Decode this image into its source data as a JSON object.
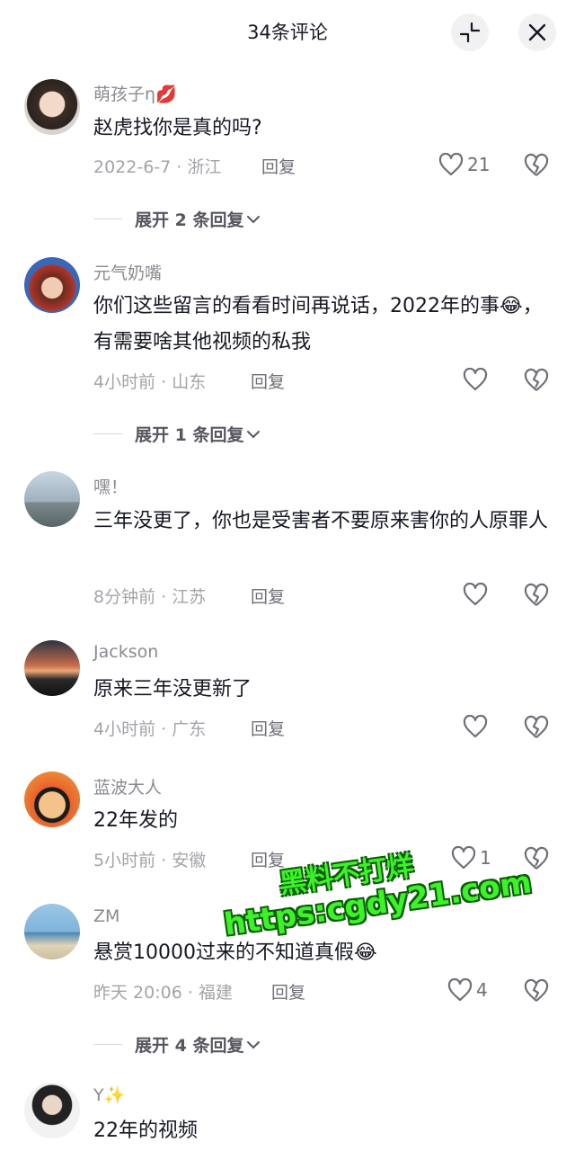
{
  "header": {
    "title": "34条评论"
  },
  "comments": [
    {
      "username": "萌孩子η💋",
      "text": "赵虎找你是真的吗?",
      "meta": "2022-6-7 · 浙江",
      "reply": "回复",
      "likes": "21",
      "expand": "展开 2 条回复"
    },
    {
      "username": "元气奶嘴",
      "text": "你们这些留言的看看时间再说话，2022年的事😂，有需要啥其他视频的私我",
      "meta": "4小时前 · 山东",
      "reply": "回复",
      "likes": "",
      "expand": "展开 1 条回复"
    },
    {
      "username": "嘿！",
      "text": "三年没更了，你也是受害者不要原来害你的人原罪人",
      "meta": "8分钟前 · 江苏",
      "reply": "回复",
      "likes": ""
    },
    {
      "username": "Jackson",
      "text": "原来三年没更新了",
      "meta": "4小时前 · 广东",
      "reply": "回复",
      "likes": ""
    },
    {
      "username": "蓝波大人",
      "text": "22年发的",
      "meta": "5小时前 · 安徽",
      "reply": "回复",
      "likes": "1"
    },
    {
      "username": "ZM",
      "text": "悬赏10000过来的不知道真假😂",
      "meta": "昨天 20:06 · 福建",
      "reply": "回复",
      "likes": "4",
      "expand": "展开 4 条回复"
    },
    {
      "username": "Y✨",
      "text": "22年的视频"
    }
  ],
  "watermark": {
    "line1": "黑料不打烊",
    "line2": "https:cgdy21.com"
  },
  "colors": {
    "accent_text": "#161823",
    "muted": "#8a8b91",
    "watermark": "#3ef22a"
  },
  "icons": [
    "collapse-icon",
    "close-icon",
    "heart-icon",
    "broken-heart-icon",
    "chevron-down-icon"
  ]
}
